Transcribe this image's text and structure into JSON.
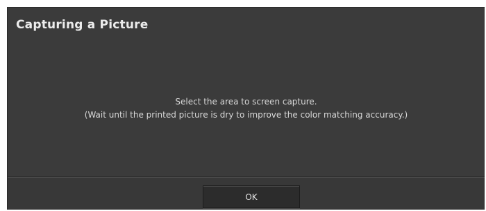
{
  "dialog": {
    "title": "Capturing a Picture",
    "message_line_1": "Select the area to screen capture.",
    "message_line_2": "(Wait until the printed picture is dry to improve the color matching accuracy.)",
    "ok_label": "OK"
  },
  "colors": {
    "dialog_background": "#3b3b3b",
    "button_background": "#2c2c2c",
    "text": "#d8d8d8"
  }
}
